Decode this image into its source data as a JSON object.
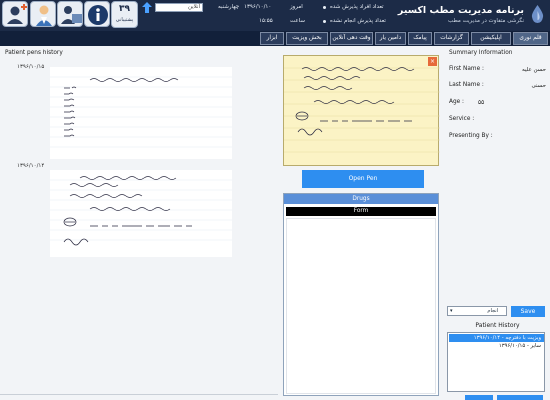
{
  "header": {
    "app_title": "برنامه مدیریت مطب اکسیر",
    "app_subtitle": "نگرشی متفاوت در مدیریت مطب",
    "today_label": "امروز",
    "date": "۱۳۹۶/۱۰/۱۰",
    "weekday": "چهارشنبه",
    "time_label": "ساعت",
    "time": "۱۵:۵۵",
    "admitted_label": "تعداد افراد پذیرش شده",
    "remaining_label": "تعداد پذیرش انجام نشده",
    "online_label": "آنلاین",
    "support_count": "۳۹",
    "support_label": "پشتیبانی"
  },
  "nav": {
    "tabs": [
      {
        "label": "قلم نوری",
        "active": true
      },
      {
        "label": "اپلیکیشن",
        "active": false
      },
      {
        "label": "گزارشات",
        "active": false
      },
      {
        "label": "پیامک",
        "active": false
      },
      {
        "label": "دامین یار",
        "active": false
      },
      {
        "label": "وقت دهی آنلاین",
        "active": false
      },
      {
        "label": "بخش ویزیت",
        "active": false
      },
      {
        "label": "ابزار",
        "active": false
      }
    ]
  },
  "history": {
    "title": "Patient pens history",
    "entries": [
      {
        "date": "۱۳۹۶/۱۰/۱۵"
      },
      {
        "date": "۱۳۹۶/۱۰/۱۴"
      }
    ]
  },
  "open_pen_label": "Open Pen",
  "drugs": {
    "title": "Drugs",
    "form_label": "Form"
  },
  "summary": {
    "title": "Summary Information",
    "first_name_label": "First Name :",
    "first_name_value": "حسن علیه",
    "last_name_label": "Last Name :",
    "last_name_value": "حسنی",
    "age_label": "Age :",
    "age_value": "۵۵",
    "service_label": "Service :",
    "presenting_by_label": "Presenting By :",
    "select_value": "انجام",
    "save_label": "Save"
  },
  "patient_history": {
    "title": "Patient History",
    "items": [
      {
        "label": "ویزیت با دفترچه - ۱۳۹۶/۱۰/۱۴",
        "selected": true
      },
      {
        "label": "سایر - ۱۳۹۶/۱۰/۱۵",
        "selected": false
      }
    ]
  },
  "colors": {
    "header_bg": "#1c2b47",
    "nav_bg": "#12203a",
    "accent_blue": "#2e8ef0",
    "drugs_header": "#5a8fd8",
    "preview_bg": "#fbf3c5"
  }
}
